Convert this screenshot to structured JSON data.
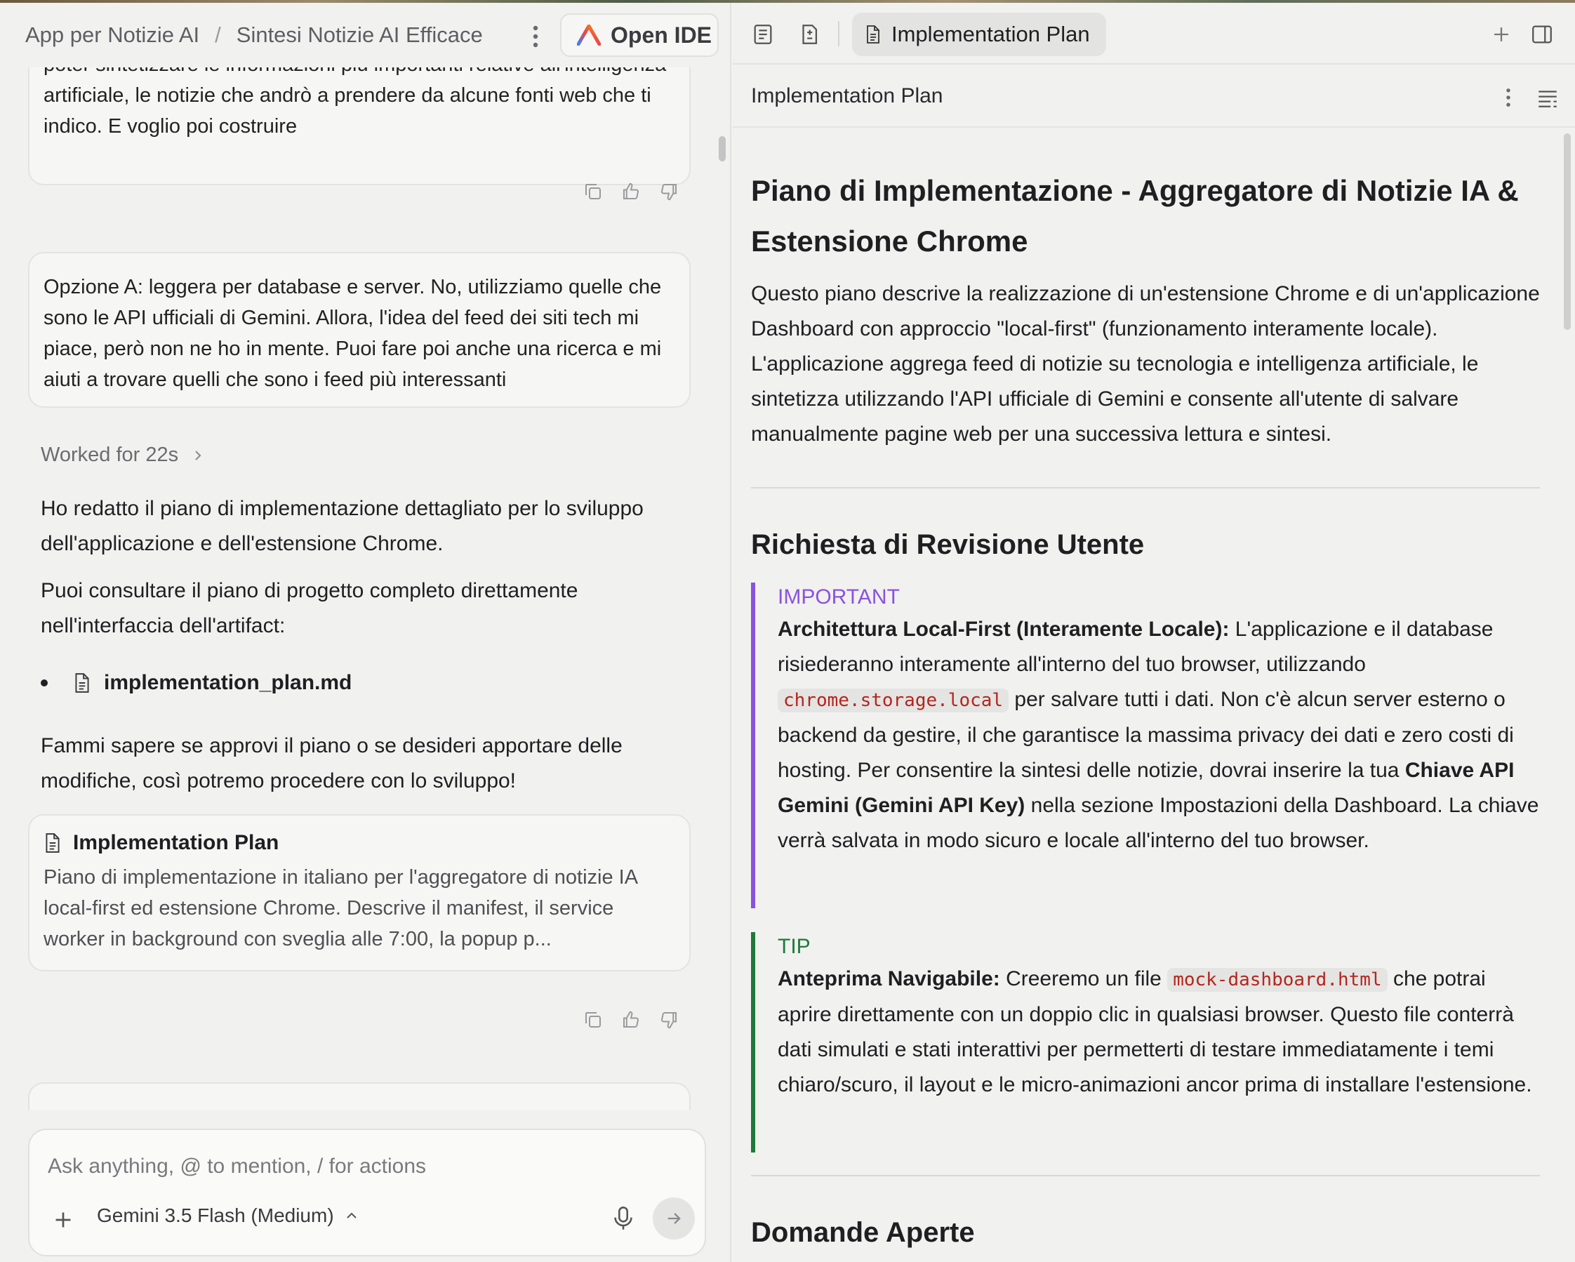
{
  "breadcrumb": {
    "project": "App per Notizie AI",
    "separator": "/",
    "conversation": "Sintesi Notizie AI Efficace"
  },
  "toolbar": {
    "open_ide_label": "Open IDE"
  },
  "chat": {
    "messages": [
      {
        "text": "Antigravity, io voglio realizzare un'applicazione che mi permetta di poter sintetizzare le informazioni più importanti relative all'intelligenza artificiale, le notizie che andrò a prendere da alcune fonti web che ti indico. E voglio poi costruire"
      },
      {
        "text": "Opzione A: leggera per database e server. No, utilizziamo quelle che sono le API ufficiali di Gemini. Allora, l'idea del feed dei siti tech mi piace, però non ne ho in mente. Puoi fare poi anche una ricerca e mi aiuti a trovare quelli che sono i feed più interessanti"
      }
    ],
    "worked_for": "Worked for 22s",
    "response": {
      "p1": "Ho redatto il piano di implementazione dettagliato per lo sviluppo dell'applicazione e dell'estensione Chrome.",
      "p2": "Puoi consultare il piano di progetto completo direttamente nell'interfaccia dell'artifact:",
      "file": "implementation_plan.md",
      "p3": "Fammi sapere se approvi il piano o se desideri apportare delle modifiche, così potremo procedere con lo sviluppo!"
    },
    "artifact_card": {
      "title": "Implementation Plan",
      "description": "Piano di implementazione in italiano per l'aggregatore di notizie IA local-first ed estensione Chrome. Descrive il manifest, il service worker in background con sveglia alle 7:00, la popup p..."
    }
  },
  "composer": {
    "placeholder": "Ask anything, @ to mention, / for actions",
    "model": "Gemini 3.5 Flash (Medium)"
  },
  "right_panel": {
    "tab_label": "Implementation Plan",
    "doc_header_title": "Implementation Plan",
    "doc": {
      "h1": "Piano di Implementazione - Aggregatore di Notizie IA & Estensione Chrome",
      "intro": "Questo piano descrive la realizzazione di un'estensione Chrome e di un'applicazione Dashboard con approccio \"local-first\" (funzionamento interamente locale). L'applicazione aggrega feed di notizie su tecnologia e intelligenza artificiale, le sintetizza utilizzando l'API ufficiale di Gemini e consente all'utente di salvare manualmente pagine web per una successiva lettura e sintesi.",
      "section1": "Richiesta di Revisione Utente",
      "important": {
        "label": "IMPORTANT",
        "title": "Architettura Local-First (Interamente Locale):",
        "t1": " L'applicazione e il database risiederanno interamente all'interno del tuo browser, utilizzando ",
        "code": "chrome.storage.local",
        "t2": " per salvare tutti i dati. Non c'è alcun server esterno o backend da gestire, il che garantisce la massima privacy dei dati e zero costi di hosting. Per consentire la sintesi delle notizie, dovrai inserire la tua ",
        "bold2": "Chiave API Gemini (Gemini API Key)",
        "t3": " nella sezione Impostazioni della Dashboard. La chiave verrà salvata in modo sicuro e locale all'interno del tuo browser."
      },
      "tip": {
        "label": "TIP",
        "title": "Anteprima Navigabile:",
        "t1": " Creeremo un file ",
        "code": "mock-dashboard.html",
        "t2": " che potrai aprire direttamente con un doppio clic in qualsiasi browser. Questo file conterrà dati simulati e stati interattivi per permetterti di testare immediatamente i temi chiaro/scuro, il layout e le micro-animazioni ancor prima di installare l'estensione."
      },
      "section2": "Domande Aperte"
    }
  },
  "colors": {
    "important": "#8a52e0",
    "tip": "#1f7a3a",
    "code_text": "#b3261e"
  }
}
